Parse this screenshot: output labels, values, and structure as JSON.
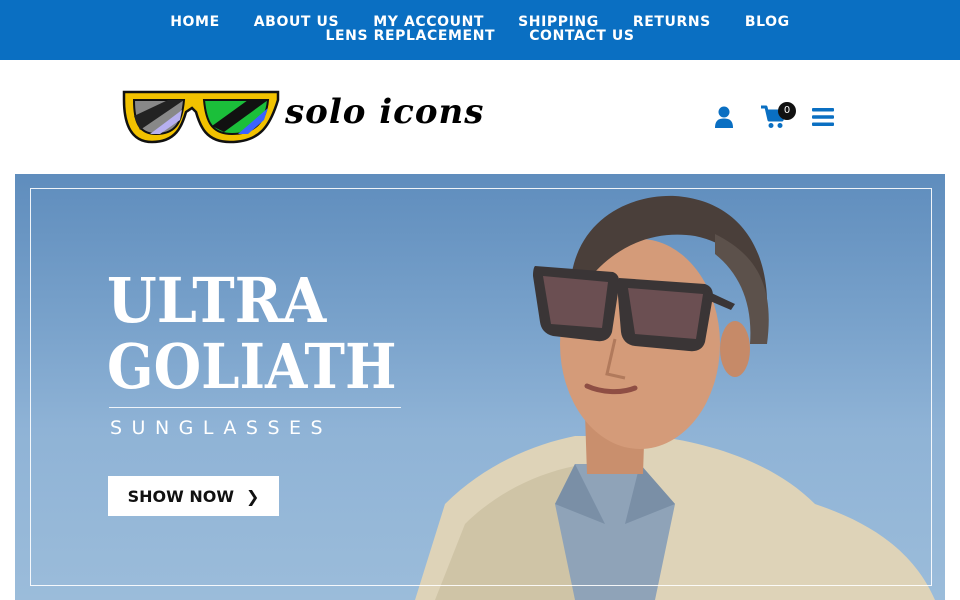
{
  "nav": {
    "row1": [
      "HOME",
      "ABOUT US",
      "MY ACCOUNT",
      "SHIPPING",
      "RETURNS",
      "BLOG"
    ],
    "row2": [
      "LENS REPLACEMENT",
      "CONTACT US"
    ]
  },
  "brand": {
    "name": "solo icons",
    "logo_icon": "sunglasses-logo"
  },
  "header_icons": {
    "user": "user-icon",
    "cart": "shopping-cart-icon",
    "cart_count": "0",
    "menu": "hamburger-menu-icon"
  },
  "hero": {
    "title_line1": "ULTRA",
    "title_line2": "GOLIATH",
    "subtitle": "SUNGLASSES",
    "button_label": "SHOW NOW",
    "button_icon": "chevron-right-icon"
  },
  "colors": {
    "nav_bg": "#0a6fc2",
    "icon_blue": "#0a6fc2",
    "logo_yellow": "#f2c200",
    "hero_sky": "#7ea7cf"
  }
}
